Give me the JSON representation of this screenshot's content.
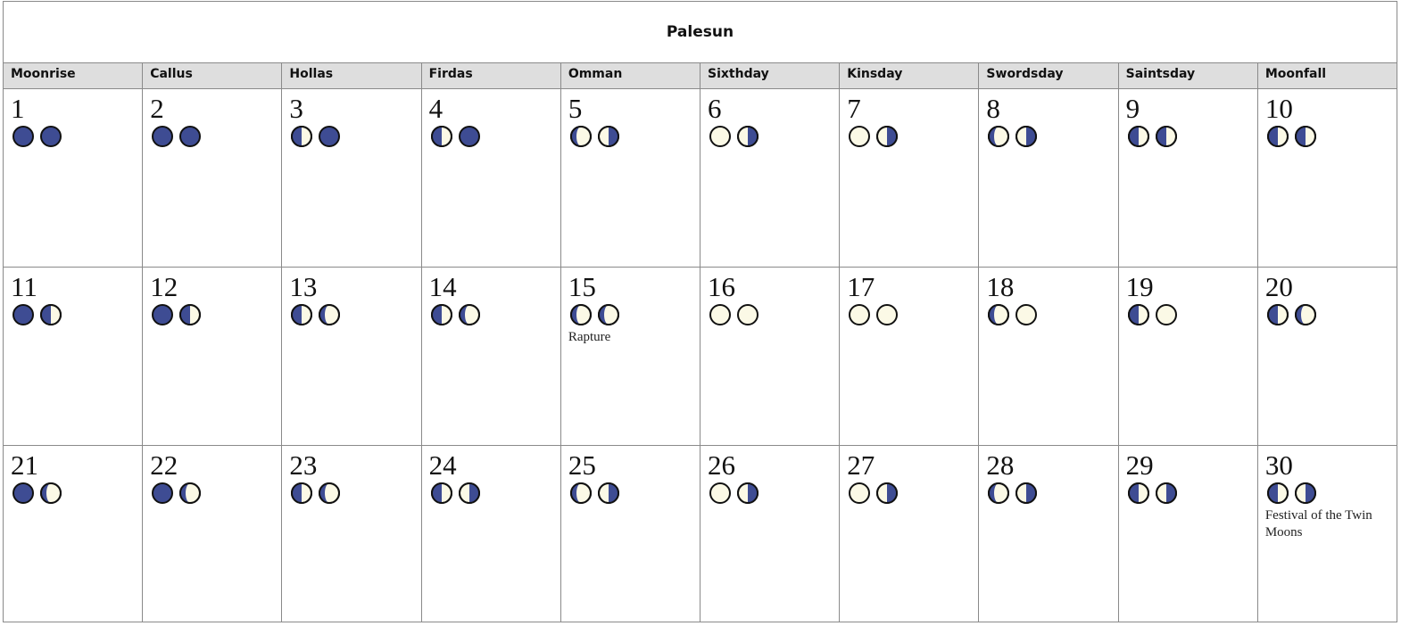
{
  "title": "Palesun",
  "colors": {
    "dark": "#3e4c93",
    "light": "#fbf9e6",
    "outline": "#111111",
    "header_bg": "#dedede",
    "grid": "#8a8a8a"
  },
  "weekdays": [
    "Moonrise",
    "Callus",
    "Hollas",
    "Firdas",
    "Omman",
    "Sixthday",
    "Kinsday",
    "Swordsday",
    "Saintsday",
    "Moonfall"
  ],
  "days": [
    {
      "num": "1",
      "moons": [
        "full-dark",
        "full-dark"
      ],
      "event": ""
    },
    {
      "num": "2",
      "moons": [
        "full-dark",
        "full-dark"
      ],
      "event": ""
    },
    {
      "num": "3",
      "moons": [
        "dark-left",
        "full-dark"
      ],
      "event": ""
    },
    {
      "num": "4",
      "moons": [
        "dark-left",
        "full-dark"
      ],
      "event": ""
    },
    {
      "num": "5",
      "moons": [
        "dark-left-thin",
        "dark-right"
      ],
      "event": ""
    },
    {
      "num": "6",
      "moons": [
        "full-light",
        "dark-right"
      ],
      "event": ""
    },
    {
      "num": "7",
      "moons": [
        "full-light",
        "dark-right"
      ],
      "event": ""
    },
    {
      "num": "8",
      "moons": [
        "dark-left-thin",
        "dark-right"
      ],
      "event": ""
    },
    {
      "num": "9",
      "moons": [
        "dark-left",
        "dark-left"
      ],
      "event": ""
    },
    {
      "num": "10",
      "moons": [
        "dark-left",
        "dark-left"
      ],
      "event": ""
    },
    {
      "num": "11",
      "moons": [
        "full-dark",
        "dark-left"
      ],
      "event": ""
    },
    {
      "num": "12",
      "moons": [
        "full-dark",
        "dark-left"
      ],
      "event": ""
    },
    {
      "num": "13",
      "moons": [
        "dark-left",
        "dark-left-thin"
      ],
      "event": ""
    },
    {
      "num": "14",
      "moons": [
        "dark-left",
        "dark-left-thin"
      ],
      "event": ""
    },
    {
      "num": "15",
      "moons": [
        "dark-left-thin",
        "dark-left-thin"
      ],
      "event": "Rapture"
    },
    {
      "num": "16",
      "moons": [
        "full-light",
        "full-light"
      ],
      "event": ""
    },
    {
      "num": "17",
      "moons": [
        "full-light",
        "full-light"
      ],
      "event": ""
    },
    {
      "num": "18",
      "moons": [
        "dark-left-thin",
        "full-light"
      ],
      "event": ""
    },
    {
      "num": "19",
      "moons": [
        "dark-left",
        "full-light"
      ],
      "event": ""
    },
    {
      "num": "20",
      "moons": [
        "dark-left",
        "dark-left-thin"
      ],
      "event": ""
    },
    {
      "num": "21",
      "moons": [
        "full-dark",
        "dark-left-thin"
      ],
      "event": ""
    },
    {
      "num": "22",
      "moons": [
        "full-dark",
        "dark-left-thin"
      ],
      "event": ""
    },
    {
      "num": "23",
      "moons": [
        "dark-left",
        "dark-left-thin"
      ],
      "event": ""
    },
    {
      "num": "24",
      "moons": [
        "dark-left",
        "dark-right"
      ],
      "event": ""
    },
    {
      "num": "25",
      "moons": [
        "dark-left-thin",
        "dark-right"
      ],
      "event": ""
    },
    {
      "num": "26",
      "moons": [
        "full-light",
        "dark-right"
      ],
      "event": ""
    },
    {
      "num": "27",
      "moons": [
        "full-light",
        "dark-right"
      ],
      "event": ""
    },
    {
      "num": "28",
      "moons": [
        "dark-left-thin",
        "dark-right"
      ],
      "event": ""
    },
    {
      "num": "29",
      "moons": [
        "dark-left",
        "dark-right"
      ],
      "event": ""
    },
    {
      "num": "30",
      "moons": [
        "dark-left",
        "dark-right"
      ],
      "event": "Festival of the Twin Moons"
    }
  ]
}
